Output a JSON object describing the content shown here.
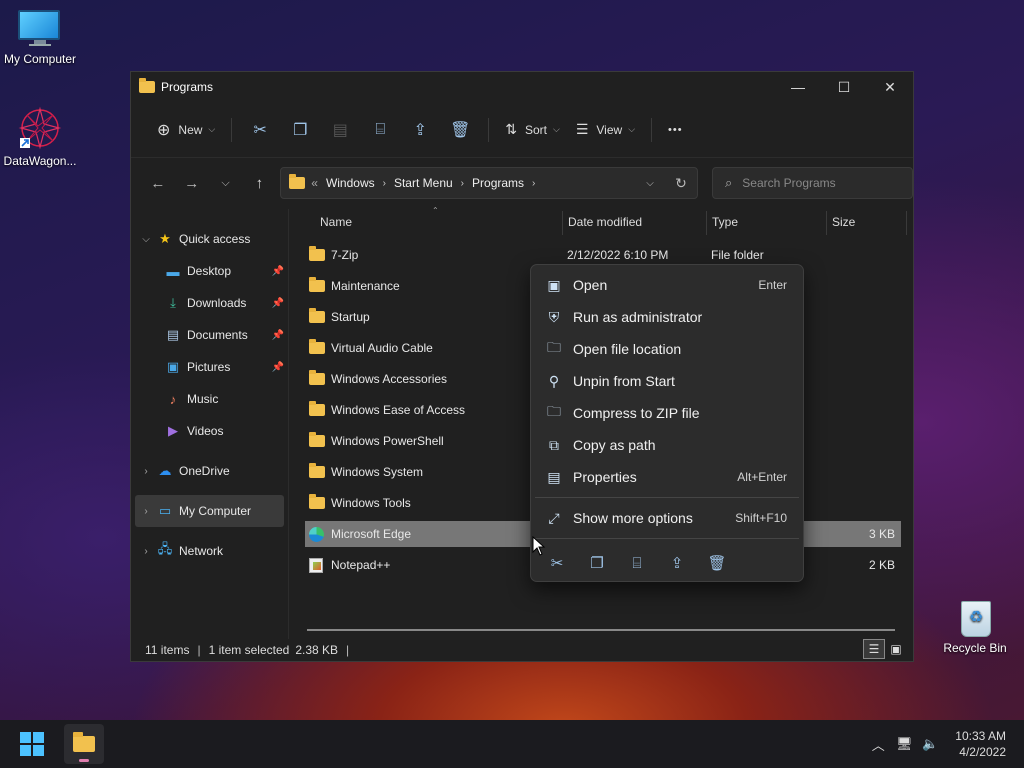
{
  "desktop": {
    "icons": [
      {
        "label": "My Computer"
      },
      {
        "label": "DataWagon..."
      },
      {
        "label": "Recycle Bin"
      }
    ]
  },
  "window": {
    "title": "Programs",
    "controls": {
      "minimize": "—",
      "maximize": "☐",
      "close": "✕"
    }
  },
  "toolbar": {
    "new_label": "New",
    "sort_label": "Sort",
    "view_label": "View",
    "more_label": "•••"
  },
  "address": {
    "more": "«",
    "crumbs": [
      "Windows",
      "Start Menu",
      "Programs"
    ],
    "search_placeholder": "Search Programs"
  },
  "nav": {
    "quick_access": "Quick access",
    "items": [
      {
        "label": "Desktop",
        "icon": "desktop-icon"
      },
      {
        "label": "Downloads",
        "icon": "downloads-icon"
      },
      {
        "label": "Documents",
        "icon": "documents-icon"
      },
      {
        "label": "Pictures",
        "icon": "pictures-icon"
      },
      {
        "label": "Music",
        "icon": "music-icon"
      },
      {
        "label": "Videos",
        "icon": "videos-icon"
      }
    ],
    "onedrive": "OneDrive",
    "my_computer": "My Computer",
    "network": "Network"
  },
  "columns": {
    "name": "Name",
    "date": "Date modified",
    "type": "Type",
    "size": "Size"
  },
  "files": [
    {
      "name": "7-Zip",
      "date": "2/12/2022 6:10 PM",
      "type": "File folder",
      "size": ""
    },
    {
      "name": "Maintenance",
      "date": "",
      "type": "",
      "size": ""
    },
    {
      "name": "Startup",
      "date": "",
      "type": "",
      "size": ""
    },
    {
      "name": "Virtual Audio Cable",
      "date": "",
      "type": "",
      "size": ""
    },
    {
      "name": "Windows Accessories",
      "date": "",
      "type": "",
      "size": ""
    },
    {
      "name": "Windows Ease of Access",
      "date": "",
      "type": "",
      "size": ""
    },
    {
      "name": "Windows PowerShell",
      "date": "",
      "type": "",
      "size": ""
    },
    {
      "name": "Windows System",
      "date": "",
      "type": "",
      "size": ""
    },
    {
      "name": "Windows Tools",
      "date": "",
      "type": "",
      "size": ""
    },
    {
      "name": "Microsoft Edge",
      "date": "",
      "type": "",
      "size": "3 KB"
    },
    {
      "name": "Notepad++",
      "date": "",
      "type": "",
      "size": "2 KB"
    }
  ],
  "status": {
    "items": "11 items",
    "selected": "1 item selected",
    "size": "2.38 KB",
    "sep": "|"
  },
  "context_menu": {
    "items": [
      {
        "label": "Open",
        "shortcut": "Enter"
      },
      {
        "label": "Run as administrator",
        "shortcut": ""
      },
      {
        "label": "Open file location",
        "shortcut": ""
      },
      {
        "label": "Unpin from Start",
        "shortcut": ""
      },
      {
        "label": "Compress to ZIP file",
        "shortcut": ""
      },
      {
        "label": "Copy as path",
        "shortcut": ""
      },
      {
        "label": "Properties",
        "shortcut": "Alt+Enter"
      }
    ],
    "more": {
      "label": "Show more options",
      "shortcut": "Shift+F10"
    }
  },
  "taskbar": {
    "time": "10:33 AM",
    "date": "4/2/2022"
  }
}
